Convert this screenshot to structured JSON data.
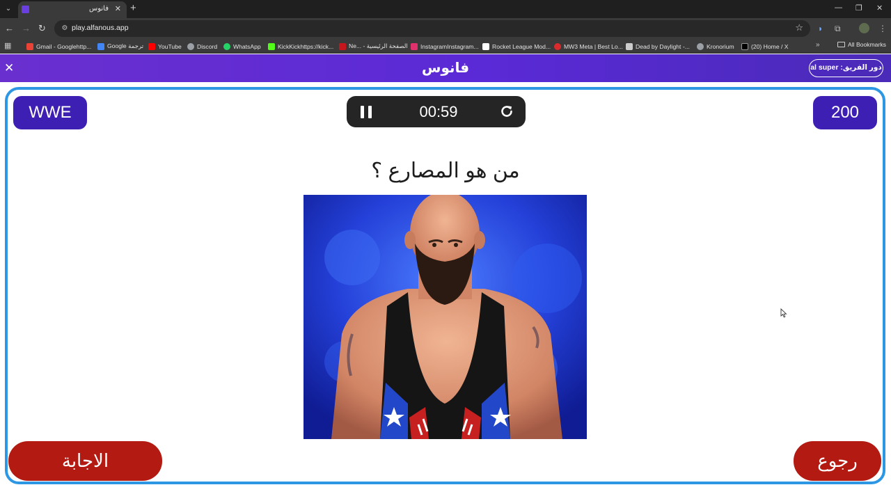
{
  "browser": {
    "tab_title": "فانوس",
    "url": "play.alfanous.app",
    "bookmarks": [
      {
        "label": "Gmail - Googlehttp...",
        "color": "#ea4335"
      },
      {
        "label": "Google ترجمة",
        "color": "#4285f4"
      },
      {
        "label": "YouTube",
        "color": "#ff0000"
      },
      {
        "label": "Discord",
        "color": "#9aa0a6"
      },
      {
        "label": "WhatsApp",
        "color": "#25d366"
      },
      {
        "label": "KickKickhttps://kick...",
        "color": "#53fc18"
      },
      {
        "label": "Ne... - الصفحة الرئيسية",
        "color": "#c4161c"
      },
      {
        "label": "InstagramInstagram...",
        "color": "#e1306c"
      },
      {
        "label": "Rocket League Mod...",
        "color": "#ffffff"
      },
      {
        "label": "MW3 Meta | Best Lo...",
        "color": "#d92b2b"
      },
      {
        "label": "Dead by Daylight -...",
        "color": "#cccccc"
      },
      {
        "label": "Kronorium",
        "color": "#9aa0a6"
      },
      {
        "label": "(20) Home / X",
        "color": "#000000"
      }
    ],
    "all_bookmarks": "All Bookmarks"
  },
  "header": {
    "logo": "فانوس",
    "turn": "دور الفريق: al super"
  },
  "game": {
    "category": "WWE",
    "points": "200",
    "timer": "00:59",
    "question": "من هو المصارع ؟",
    "answer_button": "الاجابة",
    "back_button": "رجوع"
  },
  "colors": {
    "brand": "#5a2ad6",
    "pill": "#3e1fb4",
    "card_border": "#2d97e3",
    "action": "#b31a12"
  }
}
